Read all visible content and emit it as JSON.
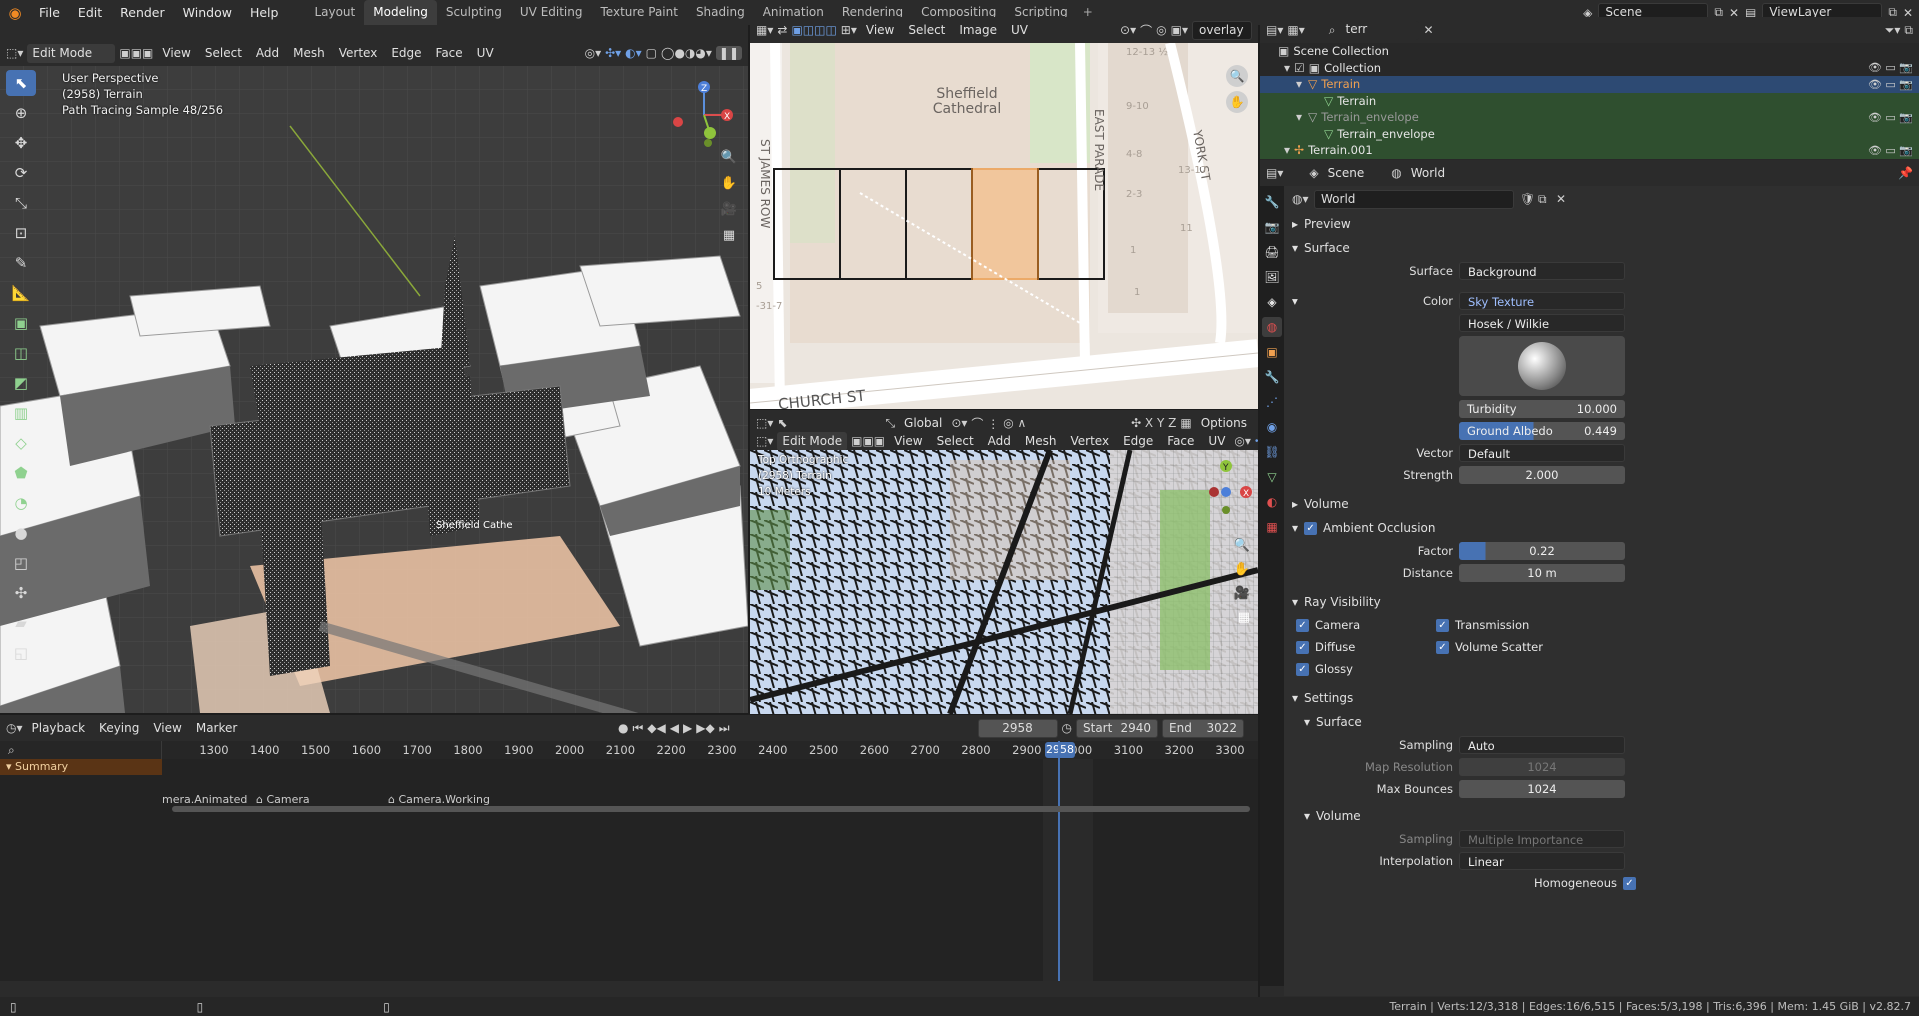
{
  "topbar": {
    "menus": [
      "File",
      "Edit",
      "Render",
      "Window",
      "Help"
    ],
    "workspaces": [
      "Layout",
      "Modeling",
      "Sculpting",
      "UV Editing",
      "Texture Paint",
      "Shading",
      "Animation",
      "Rendering",
      "Compositing",
      "Scripting"
    ],
    "active_workspace": "Modeling",
    "scene": "Scene",
    "view_layer": "ViewLayer"
  },
  "viewport3d": {
    "mode": "Edit Mode",
    "menus": [
      "View",
      "Select",
      "Add",
      "Mesh",
      "Vertex",
      "Edge",
      "Face",
      "UV"
    ],
    "orientation": "Global",
    "options": "Options",
    "info": [
      "User Perspective",
      "(2958) Terrain",
      "Path Tracing Sample 48/256"
    ],
    "label_building": "Sheffield Cathe"
  },
  "image_editor": {
    "menus": [
      "View",
      "Select",
      "Image",
      "UV"
    ],
    "image_name": "overlay",
    "map_labels": {
      "cathedral": "Sheffield Cathedral",
      "street_west": "ST JAMES ROW",
      "street_east": "EAST PARADE",
      "street_york": "YORK ST",
      "street_church": "CHURCH ST",
      "numbers": [
        "12-13 ½",
        "9-10",
        "4-8",
        "2-3",
        "1",
        "13-17",
        "11",
        "1",
        "5",
        "-31-7"
      ]
    }
  },
  "uv_editor": {
    "mode": "Edit Mode",
    "menus": [
      "View",
      "Select",
      "Add",
      "Mesh",
      "Vertex",
      "Edge",
      "Face",
      "UV"
    ],
    "orientation": "Global",
    "options": "Options",
    "info": [
      "Top Orthographic",
      "(2958) Terrain",
      "10 Meters"
    ]
  },
  "outliner": {
    "search": "terr",
    "rows": [
      {
        "name": "Scene Collection",
        "indent": 0
      },
      {
        "name": "Collection",
        "indent": 1
      },
      {
        "name": "Terrain",
        "indent": 2
      },
      {
        "name": "Terrain",
        "indent": 3
      },
      {
        "name": "Terrain_envelope",
        "indent": 2
      },
      {
        "name": "Terrain_envelope",
        "indent": 3
      },
      {
        "name": "Terrain.001",
        "indent": 1
      }
    ]
  },
  "properties": {
    "breadcrumb_scene": "Scene",
    "breadcrumb_world": "World",
    "world_name": "World",
    "panels": {
      "preview": "Preview",
      "surface": "Surface",
      "volume": "Volume",
      "ambient_occlusion": "Ambient Occlusion",
      "ray_visibility": "Ray Visibility",
      "settings": "Settings",
      "settings_surface": "Surface",
      "settings_volume": "Volume"
    },
    "surface": {
      "label": "Surface",
      "value": "Background"
    },
    "color": {
      "label": "Color",
      "value": "Sky Texture",
      "model": "Hosek / Wilkie"
    },
    "turbidity": {
      "label": "Turbidity",
      "value": "10.000"
    },
    "ground_albedo": {
      "label": "Ground Albedo",
      "value": "0.449"
    },
    "vector": {
      "label": "Vector",
      "value": "Default"
    },
    "strength": {
      "label": "Strength",
      "value": "2.000"
    },
    "ao_factor": {
      "label": "Factor",
      "value": "0.22"
    },
    "ao_distance": {
      "label": "Distance",
      "value": "10 m"
    },
    "ray": {
      "camera": "Camera",
      "diffuse": "Diffuse",
      "glossy": "Glossy",
      "transmission": "Transmission",
      "volume_scatter": "Volume Scatter"
    },
    "sampling": {
      "label": "Sampling",
      "value": "Auto"
    },
    "map_resolution": {
      "label": "Map Resolution",
      "value": "1024"
    },
    "max_bounces": {
      "label": "Max Bounces",
      "value": "1024"
    },
    "vol_sampling": {
      "label": "Sampling",
      "value": "Multiple Importance"
    },
    "interpolation": {
      "label": "Interpolation",
      "value": "Linear"
    },
    "homogeneous": "Homogeneous"
  },
  "timeline": {
    "menus": [
      "Playback",
      "Keying",
      "View",
      "Marker"
    ],
    "current_frame": "2958",
    "start_label": "Start",
    "start": "2940",
    "end_label": "End",
    "end": "3022",
    "ticks": [
      "1300",
      "1400",
      "1500",
      "1600",
      "1700",
      "1800",
      "1900",
      "2000",
      "2100",
      "2200",
      "2300",
      "2400",
      "2500",
      "2600",
      "2700",
      "2800",
      "2900",
      "3000",
      "3100",
      "3200",
      "3300"
    ],
    "summary": "Summary",
    "markers": [
      "mera.Animated",
      "Camera",
      "Camera.Working"
    ]
  },
  "statusbar": {
    "text": "Terrain | Verts:12/3,318 | Edges:16/6,515 | Faces:5/3,198 | Tris:6,396 | Mem: 1.45 GiB | v2.82.7"
  }
}
